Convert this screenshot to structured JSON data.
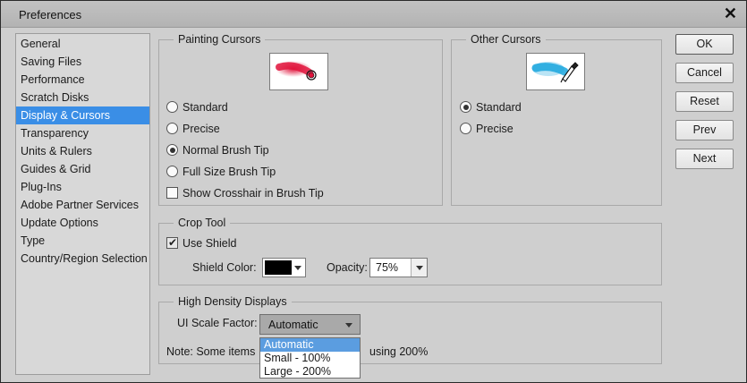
{
  "window": {
    "title": "Preferences",
    "close_glyph": "✕"
  },
  "sidebar": {
    "items": [
      {
        "label": "General",
        "selected": false
      },
      {
        "label": "Saving Files",
        "selected": false
      },
      {
        "label": "Performance",
        "selected": false
      },
      {
        "label": "Scratch Disks",
        "selected": false
      },
      {
        "label": "Display & Cursors",
        "selected": true
      },
      {
        "label": "Transparency",
        "selected": false
      },
      {
        "label": "Units & Rulers",
        "selected": false
      },
      {
        "label": "Guides & Grid",
        "selected": false
      },
      {
        "label": "Plug-Ins",
        "selected": false
      },
      {
        "label": "Adobe Partner Services",
        "selected": false
      },
      {
        "label": "Update Options",
        "selected": false
      },
      {
        "label": "Type",
        "selected": false
      },
      {
        "label": "Country/Region Selection",
        "selected": false
      }
    ]
  },
  "painting_cursors": {
    "label": "Painting Cursors",
    "preview_icon": "red-brush-cursor-preview",
    "options": [
      {
        "label": "Standard",
        "checked": false
      },
      {
        "label": "Precise",
        "checked": false
      },
      {
        "label": "Normal Brush Tip",
        "checked": true
      },
      {
        "label": "Full Size Brush Tip",
        "checked": false
      }
    ],
    "crosshair": {
      "label": "Show Crosshair in Brush Tip",
      "checked": false
    }
  },
  "other_cursors": {
    "label": "Other Cursors",
    "preview_icon": "eyedropper-cursor-preview",
    "options": [
      {
        "label": "Standard",
        "checked": true
      },
      {
        "label": "Precise",
        "checked": false
      }
    ]
  },
  "crop_tool": {
    "label": "Crop Tool",
    "use_shield": {
      "label": "Use Shield",
      "checked": true
    },
    "shield_color_label": "Shield Color:",
    "shield_color": "#000000",
    "opacity_label": "Opacity:",
    "opacity_value": "75%"
  },
  "high_density": {
    "label": "High Density Displays",
    "scale_label": "UI Scale Factor:",
    "scale_value": "Automatic",
    "note_left": "Note: Some items",
    "note_right": "using 200%",
    "dropdown_options": [
      "Automatic",
      "Small - 100%",
      "Large - 200%"
    ]
  },
  "buttons": {
    "ok": "OK",
    "cancel": "Cancel",
    "reset": "Reset",
    "prev": "Prev",
    "next": "Next"
  },
  "colors": {
    "selection": "#3a8ee6",
    "red_brush": "#e0143c",
    "blue_brush": "#1aa6de"
  }
}
